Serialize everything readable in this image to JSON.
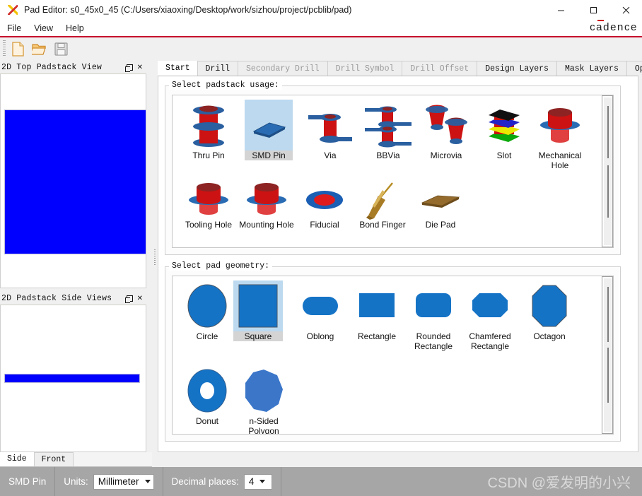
{
  "window": {
    "title": "Pad Editor: s0_45x0_45  (C:/Users/xiaoxing/Desktop/work/sizhou/project/pcblib/pad)",
    "icon": "pad-editor-icon",
    "minimize": "–",
    "maximize": "☐",
    "close": "✕"
  },
  "menu": {
    "items": [
      {
        "label": "File"
      },
      {
        "label": "View"
      },
      {
        "label": "Help"
      }
    ],
    "brand": "cadence"
  },
  "toolbar": {
    "buttons": [
      {
        "name": "new-file-button",
        "icon": "new-document-icon"
      },
      {
        "name": "open-file-button",
        "icon": "open-folder-icon"
      },
      {
        "name": "save-file-button",
        "icon": "save-disk-icon"
      }
    ]
  },
  "left_panels": [
    {
      "title": "2D Top Padstack View",
      "float_icon": "restore-icon",
      "close_icon": "✕"
    },
    {
      "title": "2D Padstack Side Views",
      "float_icon": "restore-icon",
      "close_icon": "✕"
    }
  ],
  "side_tabs": [
    {
      "label": "Side",
      "selected": true
    },
    {
      "label": "Front",
      "selected": false
    }
  ],
  "tabs": [
    {
      "label": "Start",
      "state": "active"
    },
    {
      "label": "Drill",
      "state": "enabled"
    },
    {
      "label": "Secondary Drill",
      "state": "disabled"
    },
    {
      "label": "Drill Symbol",
      "state": "disabled"
    },
    {
      "label": "Drill Offset",
      "state": "disabled"
    },
    {
      "label": "Design Layers",
      "state": "enabled"
    },
    {
      "label": "Mask Layers",
      "state": "enabled"
    },
    {
      "label": "Options",
      "state": "enabled"
    }
  ],
  "tab_nav": {
    "left": "◄",
    "right": "►"
  },
  "usage_group": {
    "label": "Select padstack usage:",
    "items": [
      {
        "label": "Thru Pin",
        "icon": "thru-pin-icon",
        "selected": false
      },
      {
        "label": "SMD Pin",
        "icon": "smd-pin-icon",
        "selected": true
      },
      {
        "label": "Via",
        "icon": "via-icon",
        "selected": false
      },
      {
        "label": "BBVia",
        "icon": "bbvia-icon",
        "selected": false
      },
      {
        "label": "Microvia",
        "icon": "microvia-icon",
        "selected": false
      },
      {
        "label": "Slot",
        "icon": "slot-icon",
        "selected": false
      },
      {
        "label": "Mechanical Hole",
        "icon": "mechanical-hole-icon",
        "selected": false
      },
      {
        "label": "Tooling Hole",
        "icon": "tooling-hole-icon",
        "selected": false
      },
      {
        "label": "Mounting Hole",
        "icon": "mounting-hole-icon",
        "selected": false
      },
      {
        "label": "Fiducial",
        "icon": "fiducial-icon",
        "selected": false
      },
      {
        "label": "Bond Finger",
        "icon": "bond-finger-icon",
        "selected": false
      },
      {
        "label": "Die Pad",
        "icon": "die-pad-icon",
        "selected": false
      }
    ]
  },
  "geometry_group": {
    "label": "Select pad geometry:",
    "items": [
      {
        "label": "Circle",
        "icon": "circle-shape-icon",
        "selected": false
      },
      {
        "label": "Square",
        "icon": "square-shape-icon",
        "selected": true
      },
      {
        "label": "Oblong",
        "icon": "oblong-shape-icon",
        "selected": false
      },
      {
        "label": "Rectangle",
        "icon": "rectangle-shape-icon",
        "selected": false
      },
      {
        "label": "Rounded Rectangle",
        "icon": "rounded-rectangle-shape-icon",
        "selected": false
      },
      {
        "label": "Chamfered Rectangle",
        "icon": "chamfered-rectangle-shape-icon",
        "selected": false
      },
      {
        "label": "Octagon",
        "icon": "octagon-shape-icon",
        "selected": false
      },
      {
        "label": "Donut",
        "icon": "donut-shape-icon",
        "selected": false
      },
      {
        "label": "n-Sided Polygon",
        "icon": "n-sided-polygon-shape-icon",
        "selected": false
      }
    ]
  },
  "status": {
    "padstack_type": "SMD Pin",
    "units_label": "Units:",
    "units_value": "Millimeter",
    "decimal_label": "Decimal places:",
    "decimal_value": "4",
    "watermark": "CSDN @爱发明的小兴"
  },
  "colors": {
    "accent_red": "#c8102e",
    "pad_blue": "#0000ff",
    "shape_blue": "#1573c6",
    "selection_blue": "#bcd9ef"
  }
}
